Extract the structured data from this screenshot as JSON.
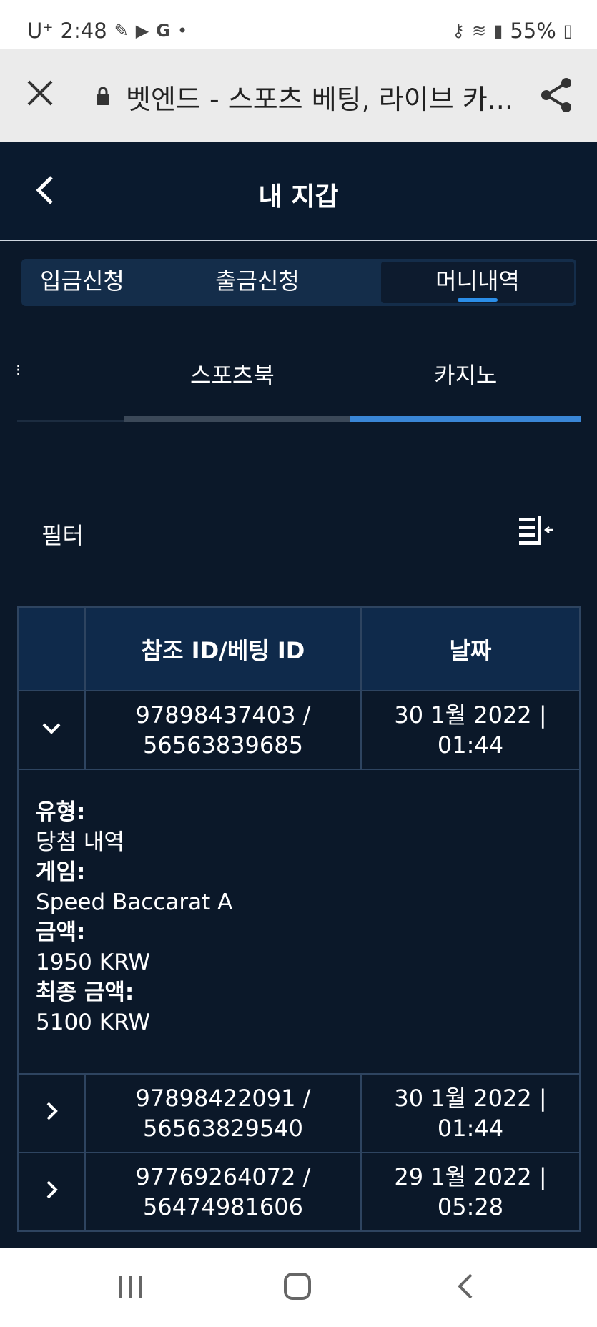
{
  "status_bar": {
    "carrier": "U⁺",
    "time": "2:48",
    "battery": "55%"
  },
  "browser": {
    "url_title": "벳엔드 - 스포츠 베팅, 라이브 카..."
  },
  "app_bar": {
    "title": "내 지갑"
  },
  "tabs": [
    {
      "label": "입금신청"
    },
    {
      "label": "출금신청"
    },
    {
      "label": "머니내역"
    }
  ],
  "subtabs": [
    {
      "label": "스포츠북"
    },
    {
      "label": "카지노"
    }
  ],
  "filter": {
    "label": "필터"
  },
  "table": {
    "headers": {
      "ref_id": "참조 ID/베팅 ID",
      "date": "날짜"
    },
    "rows": [
      {
        "ref_line1": "97898437403 /",
        "ref_line2": "56563839685",
        "date_line1": "30 1월 2022 |",
        "date_line2": "01:44"
      },
      {
        "ref_line1": "97898422091 /",
        "ref_line2": "56563829540",
        "date_line1": "30 1월 2022 |",
        "date_line2": "01:44"
      },
      {
        "ref_line1": "97769264072 /",
        "ref_line2": "56474981606",
        "date_line1": "29 1월 2022 |",
        "date_line2": "05:28"
      }
    ],
    "detail": {
      "type_label": "유형:",
      "type_value": "당첨 내역",
      "game_label": "게임:",
      "game_value": "Speed Baccarat A",
      "amount_label": "금액:",
      "amount_value": "1950 KRW",
      "final_label": "최종 금액:",
      "final_value": "5100 KRW"
    }
  },
  "colors": {
    "background": "#0b1829",
    "accent": "#2b8ee8",
    "header": "#0f2a4b"
  }
}
